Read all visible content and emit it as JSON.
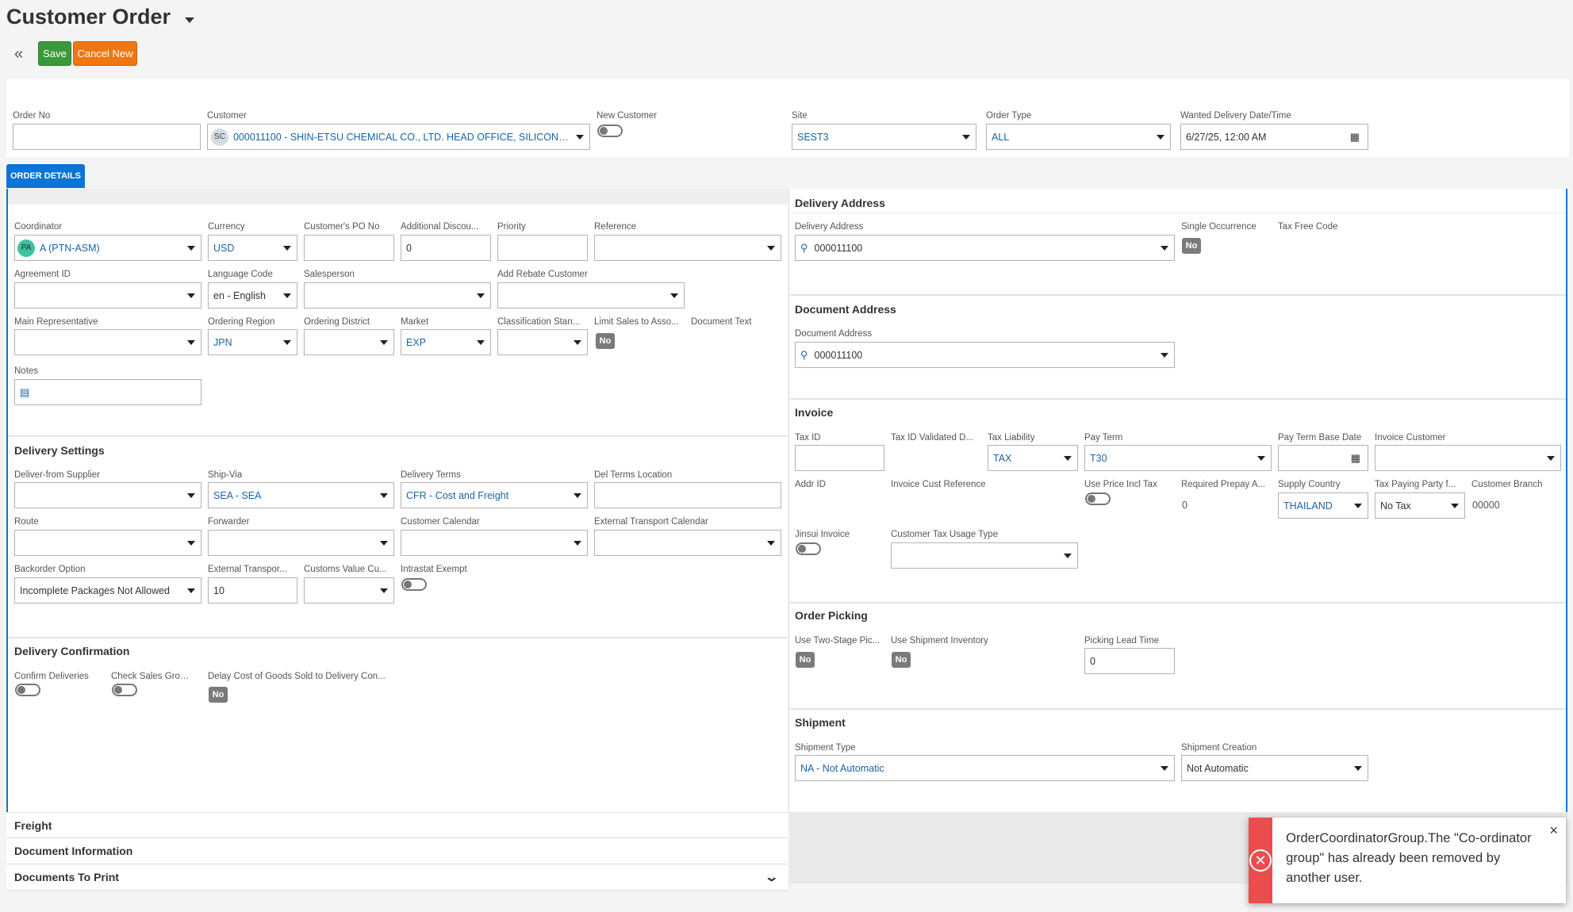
{
  "header": {
    "title": "Customer Order",
    "save": "Save",
    "cancel": "Cancel New"
  },
  "top": {
    "order_no": {
      "label": "Order No",
      "value": ""
    },
    "customer": {
      "label": "Customer",
      "avatar": "SC",
      "value": "000011100 - SHIN-ETSU CHEMICAL CO., LTD. HEAD OFFICE, SILICONE DI..."
    },
    "new_customer": {
      "label": "New Customer"
    },
    "site": {
      "label": "Site",
      "value": "SEST3"
    },
    "order_type": {
      "label": "Order Type",
      "value": "ALL"
    },
    "wanted_delivery": {
      "label": "Wanted Delivery Date/Time",
      "value": "6/27/25, 12:00 AM"
    }
  },
  "tabs": {
    "order_details": "ORDER DETAILS"
  },
  "general": {
    "coordinator": {
      "label": "Coordinator",
      "avatar": "PA",
      "value": "A (PTN-ASM)"
    },
    "currency": {
      "label": "Currency",
      "value": "USD"
    },
    "customer_po": {
      "label": "Customer's PO No",
      "value": ""
    },
    "additional_discount": {
      "label": "Additional Discou...",
      "value": "0"
    },
    "priority": {
      "label": "Priority",
      "value": ""
    },
    "reference": {
      "label": "Reference",
      "value": ""
    },
    "agreement_id": {
      "label": "Agreement ID",
      "value": ""
    },
    "language_code": {
      "label": "Language Code",
      "value": "en - English"
    },
    "salesperson": {
      "label": "Salesperson",
      "value": ""
    },
    "add_rebate_customer": {
      "label": "Add Rebate Customer",
      "value": ""
    },
    "main_representative": {
      "label": "Main Representative",
      "value": ""
    },
    "ordering_region": {
      "label": "Ordering Region",
      "value": "JPN"
    },
    "ordering_district": {
      "label": "Ordering District",
      "value": ""
    },
    "market": {
      "label": "Market",
      "value": "EXP"
    },
    "classification": {
      "label": "Classification Stan...",
      "value": ""
    },
    "limit_sales": {
      "label": "Limit Sales to Asso...",
      "value": "No"
    },
    "document_text": {
      "label": "Document Text"
    },
    "notes": {
      "label": "Notes"
    }
  },
  "delivery_settings": {
    "title": "Delivery Settings",
    "deliver_from_supplier": {
      "label": "Deliver-from Supplier",
      "value": ""
    },
    "ship_via": {
      "label": "Ship-Via",
      "value": "SEA - SEA"
    },
    "delivery_terms": {
      "label": "Delivery Terms",
      "value": "CFR - Cost and Freight"
    },
    "del_terms_location": {
      "label": "Del Terms Location",
      "value": ""
    },
    "route": {
      "label": "Route",
      "value": ""
    },
    "forwarder": {
      "label": "Forwarder",
      "value": ""
    },
    "customer_calendar": {
      "label": "Customer Calendar",
      "value": ""
    },
    "external_transport_calendar": {
      "label": "External Transport Calendar",
      "value": ""
    },
    "backorder_option": {
      "label": "Backorder Option",
      "value": "Incomplete Packages Not Allowed"
    },
    "external_transport": {
      "label": "External Transpor...",
      "value": "10"
    },
    "customs_value": {
      "label": "Customs Value Cu...",
      "value": ""
    },
    "intrastat_exempt": {
      "label": "Intrastat Exempt"
    }
  },
  "delivery_confirmation": {
    "title": "Delivery Confirmation",
    "confirm_deliveries": {
      "label": "Confirm Deliveries"
    },
    "check_sales_group": {
      "label": "Check Sales Grou..."
    },
    "delay_cost": {
      "label": "Delay Cost of Goods Sold to Delivery Con...",
      "value": "No"
    }
  },
  "delivery_address": {
    "title": "Delivery Address",
    "label": "Delivery Address",
    "value": "000011100",
    "single_occurrence": {
      "label": "Single Occurrence",
      "value": "No"
    },
    "tax_free_code": {
      "label": "Tax Free Code"
    }
  },
  "document_address": {
    "title": "Document Address",
    "label": "Document Address",
    "value": "000011100"
  },
  "invoice": {
    "title": "Invoice",
    "tax_id": {
      "label": "Tax ID",
      "value": ""
    },
    "tax_id_validated": {
      "label": "Tax ID Validated D..."
    },
    "tax_liability": {
      "label": "Tax Liability",
      "value": "TAX"
    },
    "pay_term": {
      "label": "Pay Term",
      "value": "T30"
    },
    "pay_term_base_date": {
      "label": "Pay Term Base Date",
      "value": ""
    },
    "invoice_customer": {
      "label": "Invoice Customer",
      "value": ""
    },
    "addr_id": {
      "label": "Addr ID"
    },
    "invoice_cust_reference": {
      "label": "Invoice Cust Reference"
    },
    "use_price_incl_tax": {
      "label": "Use Price Incl Tax"
    },
    "required_prepay": {
      "label": "Required Prepay A...",
      "value": "0"
    },
    "supply_country": {
      "label": "Supply Country",
      "value": "THAILAND"
    },
    "tax_paying_party": {
      "label": "Tax Paying Party f...",
      "value": "No Tax"
    },
    "customer_branch": {
      "label": "Customer Branch",
      "value": "00000"
    },
    "jinsui_invoice": {
      "label": "Jinsui Invoice"
    },
    "customer_tax_usage": {
      "label": "Customer Tax Usage Type",
      "value": ""
    }
  },
  "order_picking": {
    "title": "Order Picking",
    "two_stage": {
      "label": "Use Two-Stage Pic...",
      "value": "No"
    },
    "shipment_inventory": {
      "label": "Use Shipment Inventory",
      "value": "No"
    },
    "picking_lead_time": {
      "label": "Picking Lead Time",
      "value": "0"
    }
  },
  "shipment": {
    "title": "Shipment",
    "shipment_type": {
      "label": "Shipment Type",
      "value": "NA - Not Automatic"
    },
    "shipment_creation": {
      "label": "Shipment Creation",
      "value": "Not Automatic"
    }
  },
  "accordions": {
    "freight": "Freight",
    "document_information": "Document Information",
    "documents_to_print": "Documents To Print"
  },
  "toast": {
    "message": "OrderCoordinatorGroup.The \"Co-ordinator group\" has already been removed by another user.",
    "close": "×",
    "icon": "⊗"
  }
}
